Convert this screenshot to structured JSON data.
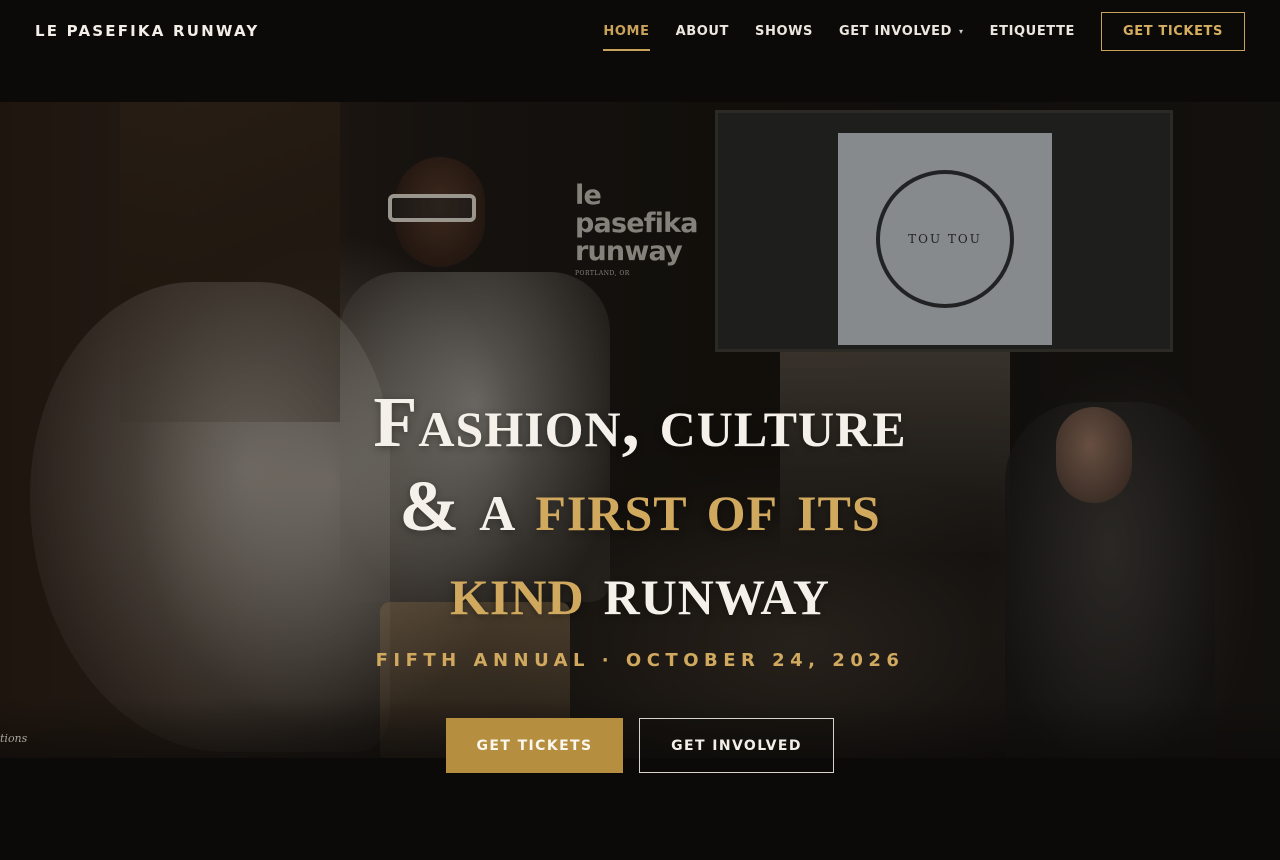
{
  "header": {
    "brand": "LE PASEFIKA RUNWAY",
    "nav": [
      {
        "label": "HOME",
        "active": true
      },
      {
        "label": "ABOUT",
        "active": false
      },
      {
        "label": "SHOWS",
        "active": false
      },
      {
        "label": "GET INVOLVED",
        "active": false,
        "has_dropdown": true
      },
      {
        "label": "ETIQUETTE",
        "active": false
      }
    ],
    "cta": "GET TICKETS"
  },
  "hero": {
    "logo_lines": [
      "le",
      "pasefika",
      "runway"
    ],
    "logo_location": "PORTLAND, OR",
    "screen_mark": "TOU TOU",
    "headline": {
      "line1": "Fashion, culture",
      "line2_white": "& a",
      "line2_gold": "first of its",
      "line3_gold": "kind",
      "line3_white": "runway"
    },
    "subline": "FIFTH ANNUAL · OCTOBER 24, 2026",
    "buttons": {
      "primary": "GET TICKETS",
      "secondary": "GET INVOLVED"
    },
    "signature": "tions"
  },
  "colors": {
    "accent": "#c9a25a",
    "background": "#0c0a09",
    "text": "#f3efe8"
  },
  "icons": {
    "dropdown": "chevron-down-icon"
  }
}
